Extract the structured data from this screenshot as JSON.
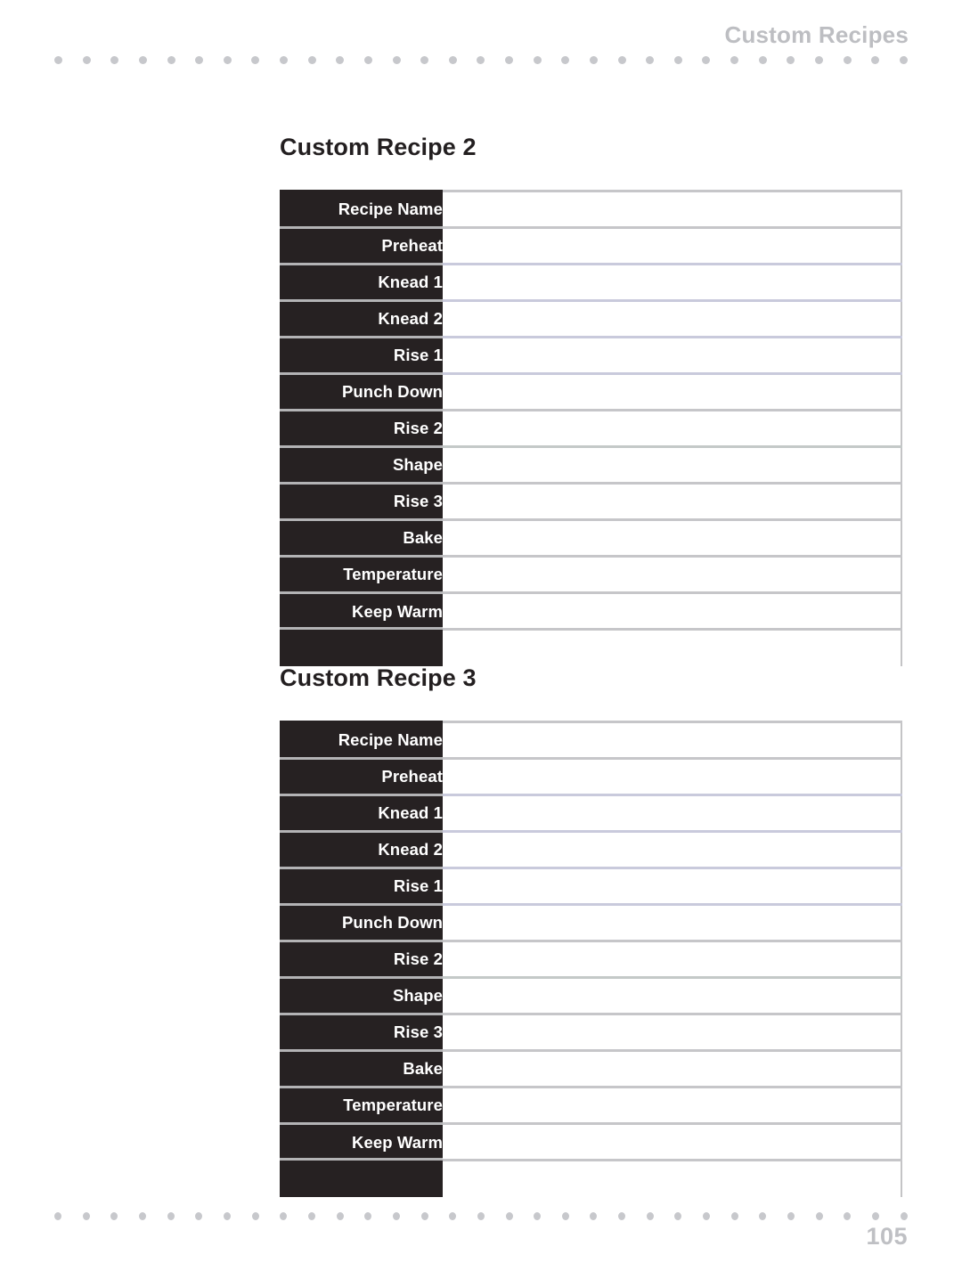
{
  "header": {
    "running_title": "Custom Recipes",
    "dot_count": 31
  },
  "footer": {
    "page_number": "105",
    "dot_count": 31
  },
  "colors": {
    "label_cell_background": "#262122",
    "label_cell_text": "#ffffff",
    "rule_gray": "#c6c6c9",
    "rule_lavender": "#c9cadc",
    "header_text": "#bdbec2",
    "title_text": "#231f20",
    "folio_text": "#bfc0c4",
    "page_background": "#ffffff"
  },
  "recipes": [
    {
      "title": "Custom Recipe 2",
      "rows": [
        {
          "label": "Recipe Name",
          "value": ""
        },
        {
          "label": "Preheat",
          "value": ""
        },
        {
          "label": "Knead 1",
          "value": ""
        },
        {
          "label": "Knead 2",
          "value": ""
        },
        {
          "label": "Rise 1",
          "value": ""
        },
        {
          "label": "Punch Down",
          "value": ""
        },
        {
          "label": "Rise 2",
          "value": ""
        },
        {
          "label": "Shape",
          "value": ""
        },
        {
          "label": "Rise 3",
          "value": ""
        },
        {
          "label": "Bake",
          "value": ""
        },
        {
          "label": "Temperature",
          "value": ""
        },
        {
          "label": "Keep Warm",
          "value": ""
        }
      ]
    },
    {
      "title": "Custom Recipe 3",
      "rows": [
        {
          "label": "Recipe Name",
          "value": ""
        },
        {
          "label": "Preheat",
          "value": ""
        },
        {
          "label": "Knead 1",
          "value": ""
        },
        {
          "label": "Knead 2",
          "value": ""
        },
        {
          "label": "Rise 1",
          "value": ""
        },
        {
          "label": "Punch Down",
          "value": ""
        },
        {
          "label": "Rise 2",
          "value": ""
        },
        {
          "label": "Shape",
          "value": ""
        },
        {
          "label": "Rise 3",
          "value": ""
        },
        {
          "label": "Bake",
          "value": ""
        },
        {
          "label": "Temperature",
          "value": ""
        },
        {
          "label": "Keep Warm",
          "value": ""
        }
      ]
    }
  ]
}
